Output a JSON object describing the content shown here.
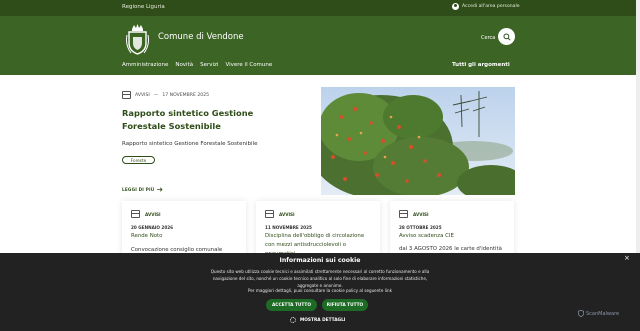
{
  "top_bar": {
    "region": "Regione Liguria",
    "login": "Accedi all'area personale"
  },
  "header": {
    "title": "Comune di Vendone",
    "search_label": "Cerca",
    "nav": [
      "Amministrazione",
      "Novità",
      "Servizi",
      "Vivere il Comune"
    ],
    "all_topics": "Tutti gli argomenti"
  },
  "hero": {
    "category": "AVVISI",
    "separator": "—",
    "date": "17 NOVEMBRE 2025",
    "title": "Rapporto sintetico Gestione Forestale Sostenibile",
    "description": "Rapporto sintetico Gestione Forestale Sostenibile",
    "tag": "Foreste",
    "read_more": "LEGGI DI PIÙ"
  },
  "cards": [
    {
      "category": "AVVISI",
      "date": "20 GENNAIO 2026",
      "title": "Rende Noto",
      "excerpt": "Convocazione consiglio comunale"
    },
    {
      "category": "AVVISI",
      "date": "11 NOVEMBRE 2025",
      "title": "Disciplina dell'obbligo di circolazione con mezzi antisdrucciolevoli o pneumatici",
      "excerpt": ""
    },
    {
      "category": "AVVISI",
      "date": "28 OTTOBRE 2025",
      "title": "Avviso scadenza CIE",
      "excerpt": "dal 3 AGOSTO 2026 le carte d'identità"
    }
  ],
  "cookie": {
    "title": "Informazioni sui cookie",
    "body": "Questo sito web utilizza cookie tecnici e assimilati strettamente necessari al corretto funzionamento e alla navigazione del sito, nonché un cookie tecnico analitico al solo fine di elaborare informazioni statistiche, aggregate e anonime.",
    "note": "Per maggiori dettagli, puoi consultare la cookie policy al seguente link",
    "accept": "ACCETTA TUTTO",
    "reject": "RIFIUTA TUTTO",
    "details": "MOSTRA DETTAGLI",
    "close": "×"
  },
  "watermark": "ScanMalware",
  "colors": {
    "header_dark": "#2f4d19",
    "header": "#3c6425",
    "accent": "#2f4d19",
    "button": "#1e6b26",
    "banner": "#222222"
  }
}
